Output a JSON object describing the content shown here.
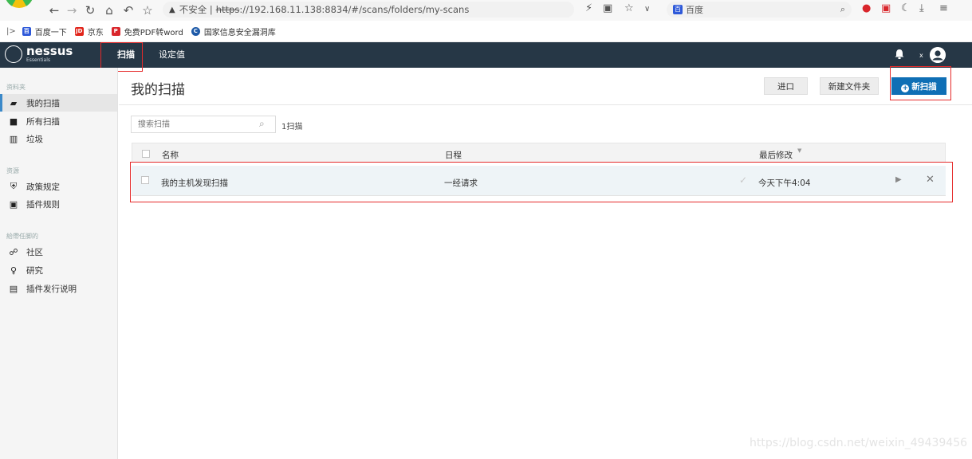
{
  "browser": {
    "insecure_label": "不安全 |",
    "url_scheme": "https",
    "url_rest": "://192.168.11.138:8834/#/scans/folders/my-scans",
    "search_engine": "百度"
  },
  "bookmarks": [
    {
      "label": "百度一下",
      "icon_color": "#2e59d9",
      "icon_text": "百"
    },
    {
      "label": "京东",
      "icon_color": "#e1251b",
      "icon_text": "JD"
    },
    {
      "label": "免费PDF转word",
      "icon_color": "#d9262c",
      "icon_text": "P"
    },
    {
      "label": "国家信息安全漏洞库",
      "icon_color": "#1e5aa8",
      "icon_text": "C"
    }
  ],
  "topnav": {
    "logo_text": "nessus",
    "logo_sub": "Essentials",
    "tabs": [
      "扫描",
      "设定值"
    ],
    "user_label": "x"
  },
  "sidebar": {
    "section1": "资料夹",
    "section2": "资源",
    "section3": "給帶任脚的",
    "items": [
      {
        "label": "我的扫描",
        "icon": "folder-open-icon"
      },
      {
        "label": "所有扫描",
        "icon": "folder-icon"
      },
      {
        "label": "垃圾",
        "icon": "trash-icon"
      },
      {
        "label": "政策规定",
        "icon": "shield-icon"
      },
      {
        "label": "插件规则",
        "icon": "plugin-rules-icon"
      },
      {
        "label": "社区",
        "icon": "community-icon"
      },
      {
        "label": "研究",
        "icon": "lightbulb-icon"
      },
      {
        "label": "插件发行说明",
        "icon": "document-icon"
      }
    ]
  },
  "main": {
    "title": "我的扫描",
    "import_label": "进口",
    "new_folder_label": "新建文件夹",
    "new_scan_label": "新扫描",
    "search_placeholder": "搜索扫描",
    "count_label": "1扫描",
    "columns": [
      "名称",
      "日程",
      "最后修改"
    ],
    "rows": [
      {
        "name": "我的主机发现扫描",
        "schedule": "一经请求",
        "modified": "今天下午4:04"
      }
    ]
  },
  "watermark": "https://blog.csdn.net/weixin_49439456",
  "colors": {
    "nav_bg": "#263746",
    "primary": "#0f6fb5",
    "highlight": "#e52a2a"
  }
}
